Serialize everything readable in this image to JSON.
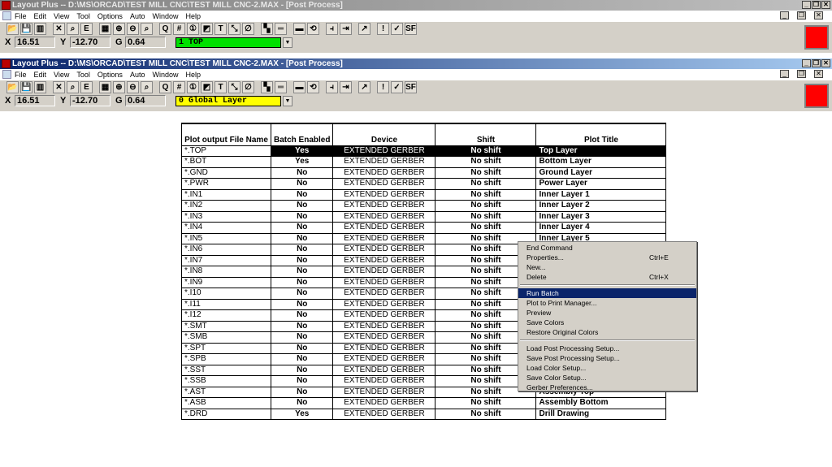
{
  "windows": [
    {
      "title": "Layout Plus -- D:\\MS\\ORCAD\\TEST MILL CNC\\TEST MILL CNC-2.MAX - [Post Process]",
      "layer": "1 TOP",
      "layer_color": "#00e000"
    },
    {
      "title": "Layout Plus -- D:\\MS\\ORCAD\\TEST MILL CNC\\TEST MILL CNC-2.MAX - [Post Process]",
      "layer": "0 Global Layer",
      "layer_color": "#ffff00"
    }
  ],
  "menu": [
    "File",
    "Edit",
    "View",
    "Tool",
    "Options",
    "Auto",
    "Window",
    "Help"
  ],
  "coords": {
    "x_label": "X",
    "x": "16.51",
    "y_label": "Y",
    "y": "-12.70",
    "g_label": "G",
    "g": "0.64"
  },
  "toolbar": [
    "open",
    "save",
    "stack",
    "cancel",
    "find",
    "E",
    "spreadsheet",
    "zoom-in",
    "zoom-out",
    "zoom-all",
    "query",
    "grid",
    "pin",
    "color",
    "text",
    "connect",
    "obstacle",
    "colors",
    "drc",
    "component",
    "reconnect",
    "shove",
    "autoroute",
    "route",
    "error",
    "drc-check",
    "sf"
  ],
  "toolbar_glyphs": [
    "📂",
    "💾",
    "▥",
    "✕",
    "⌕",
    "E",
    "▦",
    "⊕",
    "⊖",
    "⌕",
    "Q",
    "#",
    "①",
    "◩",
    "T",
    "⤡",
    "∅",
    "▚",
    "═",
    "▬",
    "⟲",
    "⫞",
    "⇥",
    "↗",
    "!",
    "✓",
    "SF"
  ],
  "table": {
    "headers": [
      "Plot output File Name",
      "Batch Enabled",
      "Device",
      "Shift",
      "Plot Title"
    ],
    "rows": [
      [
        "*.TOP",
        "Yes",
        "EXTENDED GERBER",
        "No shift",
        "Top Layer"
      ],
      [
        "*.BOT",
        "Yes",
        "EXTENDED GERBER",
        "No shift",
        "Bottom Layer"
      ],
      [
        "*.GND",
        "No",
        "EXTENDED GERBER",
        "No shift",
        "Ground Layer"
      ],
      [
        "*.PWR",
        "No",
        "EXTENDED GERBER",
        "No shift",
        "Power Layer"
      ],
      [
        "*.IN1",
        "No",
        "EXTENDED GERBER",
        "No shift",
        "Inner Layer  1"
      ],
      [
        "*.IN2",
        "No",
        "EXTENDED GERBER",
        "No shift",
        "Inner Layer  2"
      ],
      [
        "*.IN3",
        "No",
        "EXTENDED GERBER",
        "No shift",
        "Inner Layer  3"
      ],
      [
        "*.IN4",
        "No",
        "EXTENDED GERBER",
        "No shift",
        "Inner Layer  4"
      ],
      [
        "*.IN5",
        "No",
        "EXTENDED GERBER",
        "No shift",
        "Inner Layer  5"
      ],
      [
        "*.IN6",
        "No",
        "EXTENDED GERBER",
        "No shift",
        ""
      ],
      [
        "*.IN7",
        "No",
        "EXTENDED GERBER",
        "No shift",
        ""
      ],
      [
        "*.IN8",
        "No",
        "EXTENDED GERBER",
        "No shift",
        ""
      ],
      [
        "*.IN9",
        "No",
        "EXTENDED GERBER",
        "No shift",
        ""
      ],
      [
        "*.I10",
        "No",
        "EXTENDED GERBER",
        "No shift",
        ""
      ],
      [
        "*.I11",
        "No",
        "EXTENDED GERBER",
        "No shift",
        ""
      ],
      [
        "*.I12",
        "No",
        "EXTENDED GERBER",
        "No shift",
        ""
      ],
      [
        "*.SMT",
        "No",
        "EXTENDED GERBER",
        "No shift",
        ""
      ],
      [
        "*.SMB",
        "No",
        "EXTENDED GERBER",
        "No shift",
        ""
      ],
      [
        "*.SPT",
        "No",
        "EXTENDED GERBER",
        "No shift",
        ""
      ],
      [
        "*.SPB",
        "No",
        "EXTENDED GERBER",
        "No shift",
        ""
      ],
      [
        "*.SST",
        "No",
        "EXTENDED GERBER",
        "No shift",
        ""
      ],
      [
        "*.SSB",
        "No",
        "EXTENDED GERBER",
        "No shift",
        ""
      ],
      [
        "*.AST",
        "No",
        "EXTENDED GERBER",
        "No shift",
        "Assembly Top"
      ],
      [
        "*.ASB",
        "No",
        "EXTENDED GERBER",
        "No shift",
        "Assembly Bottom"
      ],
      [
        "*.DRD",
        "Yes",
        "EXTENDED GERBER",
        "No shift",
        "Drill Drawing"
      ]
    ],
    "selected_row": 0
  },
  "context_menu": [
    {
      "label": "End Command"
    },
    {
      "label": "Properties...",
      "shortcut": "Ctrl+E"
    },
    {
      "label": "New..."
    },
    {
      "label": "Delete",
      "shortcut": "Ctrl+X"
    },
    {
      "sep": true
    },
    {
      "label": "Run Batch",
      "highlighted": true
    },
    {
      "label": "Plot to Print Manager..."
    },
    {
      "label": "Preview"
    },
    {
      "label": "Save Colors"
    },
    {
      "label": "Restore Original Colors"
    },
    {
      "sep": true
    },
    {
      "label": "Load Post Processing Setup..."
    },
    {
      "label": "Save Post Processing Setup..."
    },
    {
      "label": "Load Color Setup..."
    },
    {
      "label": "Save Color Setup..."
    },
    {
      "label": "Gerber Preferences..."
    }
  ]
}
